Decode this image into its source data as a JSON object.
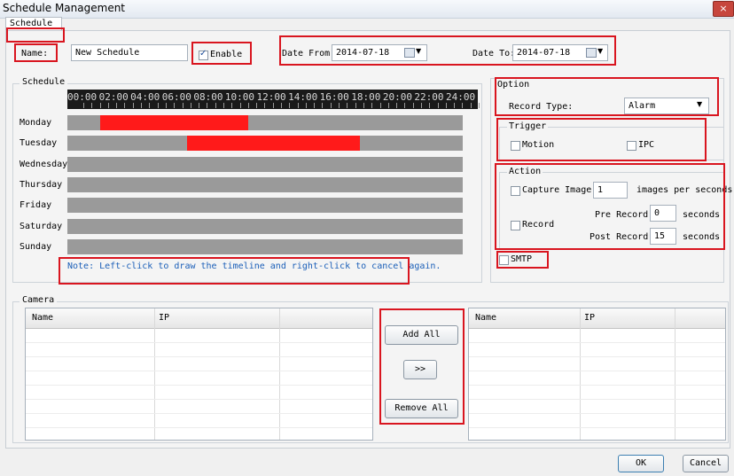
{
  "window": {
    "title": "Schedule Management",
    "close_glyph": "×"
  },
  "tab": {
    "label": "Schedule"
  },
  "form": {
    "name_label": "Name:",
    "name_value": "New Schedule",
    "enable_label": "Enable",
    "enable_checked": true,
    "date_from_label": "Date From:",
    "date_from_value": "2014-07-18",
    "date_to_label": "Date To:",
    "date_to_value": "2014-07-18"
  },
  "schedule": {
    "group_label": "Schedule",
    "time_labels": [
      "00:00",
      "02:00",
      "04:00",
      "06:00",
      "08:00",
      "10:00",
      "12:00",
      "14:00",
      "16:00",
      "18:00",
      "20:00",
      "22:00",
      "24:00"
    ],
    "days": [
      {
        "label": "Monday",
        "segments": [
          [
            2,
            11
          ]
        ]
      },
      {
        "label": "Tuesday",
        "segments": [
          [
            7.25,
            17.75
          ]
        ]
      },
      {
        "label": "Wednesday",
        "segments": []
      },
      {
        "label": "Thursday",
        "segments": []
      },
      {
        "label": "Friday",
        "segments": []
      },
      {
        "label": "Saturday",
        "segments": []
      },
      {
        "label": "Sunday",
        "segments": []
      }
    ],
    "note": "Note: Left-click to draw the timeline and right-click to cancel again.",
    "segment_color": "#ff1a1a",
    "row_color": "#9a9a9a"
  },
  "option": {
    "group_label": "Option",
    "record_type_label": "Record Type:",
    "record_type_value": "Alarm",
    "trigger_label": "Trigger",
    "motion_label": "Motion",
    "ipc_label": "IPC",
    "action_label": "Action",
    "capture_label": "Capture Image",
    "capture_value": "1",
    "capture_unit": "images per seconds",
    "record_label": "Record",
    "pre_record_label": "Pre Record:",
    "pre_record_value": "0",
    "post_record_label": "Post Record:",
    "post_record_value": "15",
    "seconds_label": "seconds",
    "smtp_label": "SMTP"
  },
  "camera": {
    "group_label": "Camera",
    "left_headers": [
      "Name",
      "IP"
    ],
    "right_headers": [
      "Name",
      "IP"
    ],
    "add_all": "Add All",
    "move": ">>",
    "remove_all": "Remove All"
  },
  "footer": {
    "ok": "OK",
    "cancel": "Cancel"
  },
  "colors": {
    "highlight": "#d9151f"
  }
}
